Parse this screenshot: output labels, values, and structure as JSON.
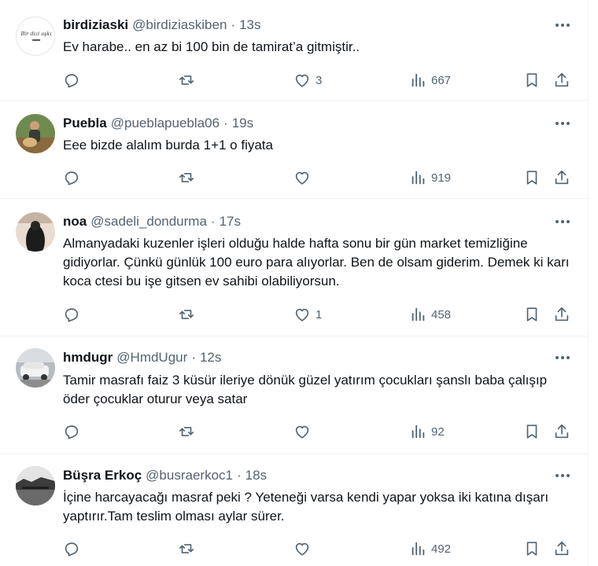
{
  "tweets": [
    {
      "name": "birdiziaski",
      "handle": "@birdiziaskiben",
      "time": "13s",
      "text": "Ev harabe.. en az bi 100 bin de tamirat’a gitmiştir..",
      "replies": "",
      "retweets": "",
      "likes": "3",
      "views": "667",
      "avatar_text": "Bir dizi aşkı"
    },
    {
      "name": "Puebla",
      "handle": "@pueblapuebla06",
      "time": "19s",
      "text": "Eee bizde alalım burda 1+1 o fiyata",
      "replies": "",
      "retweets": "",
      "likes": "",
      "views": "919"
    },
    {
      "name": "noa",
      "handle": "@sadeli_dondurma",
      "time": "17s",
      "text": "Almanyadaki kuzenler işleri olduğu halde hafta sonu bir gün market temizliğine gidiyorlar. Çünkü günlük 100 euro para alıyorlar. Ben de olsam giderim. Demek ki karı koca ctesi bu işe gitsen ev sahibi olabiliyorsun.",
      "replies": "",
      "retweets": "",
      "likes": "1",
      "views": "458"
    },
    {
      "name": "hmdugr",
      "handle": "@HmdUgur",
      "time": "12s",
      "text": "Tamir masrafı faiz 3 küsür ileriye dönük güzel yatırım çocukları şanslı baba çalışıp öder çocuklar oturur veya satar",
      "replies": "",
      "retweets": "",
      "likes": "",
      "views": "92"
    },
    {
      "name": "Büşra Erkoç",
      "handle": "@busraerkoc1",
      "time": "18s",
      "text": "İçine harcayacağı masraf peki ? Yeteneği varsa kendi yapar yoksa iki katına dışarı yaptırır.Tam teslim olması aylar sürer.",
      "replies": "",
      "retweets": "",
      "likes": "",
      "views": "492"
    }
  ],
  "separator": "·",
  "colors": {
    "text": "#0f1419",
    "secondary": "#536471",
    "border": "#eff3f4"
  },
  "icons": {
    "more": "more-dots-icon",
    "reply": "reply-icon",
    "retweet": "retweet-icon",
    "like": "heart-icon",
    "views": "views-icon",
    "bookmark": "bookmark-icon",
    "share": "share-icon"
  }
}
